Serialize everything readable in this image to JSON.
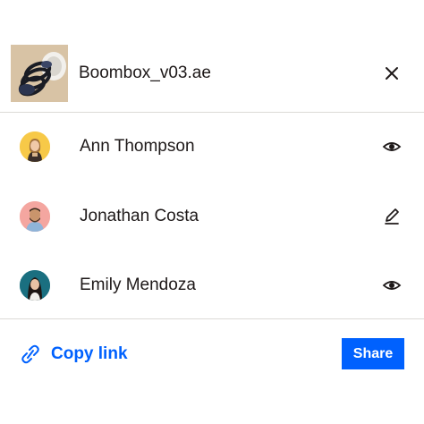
{
  "file": {
    "name": "Boombox_v03.ae",
    "thumbnail_icon": "headphones-thumbnail"
  },
  "header": {
    "close_icon": "close-icon"
  },
  "people": [
    {
      "name": "Ann Thompson",
      "permission_icon": "eye-icon",
      "avatar_color": "#f7c948"
    },
    {
      "name": "Jonathan Costa",
      "permission_icon": "pencil-icon",
      "avatar_color": "#f4a6a0"
    },
    {
      "name": "Emily Mendoza",
      "permission_icon": "eye-icon",
      "avatar_color": "#1a6f80"
    }
  ],
  "footer": {
    "copy_link_label": "Copy link",
    "copy_link_icon": "link-icon",
    "share_label": "Share"
  },
  "colors": {
    "accent": "#0061fe",
    "divider": "#dcdad6",
    "text": "#1e1919"
  }
}
